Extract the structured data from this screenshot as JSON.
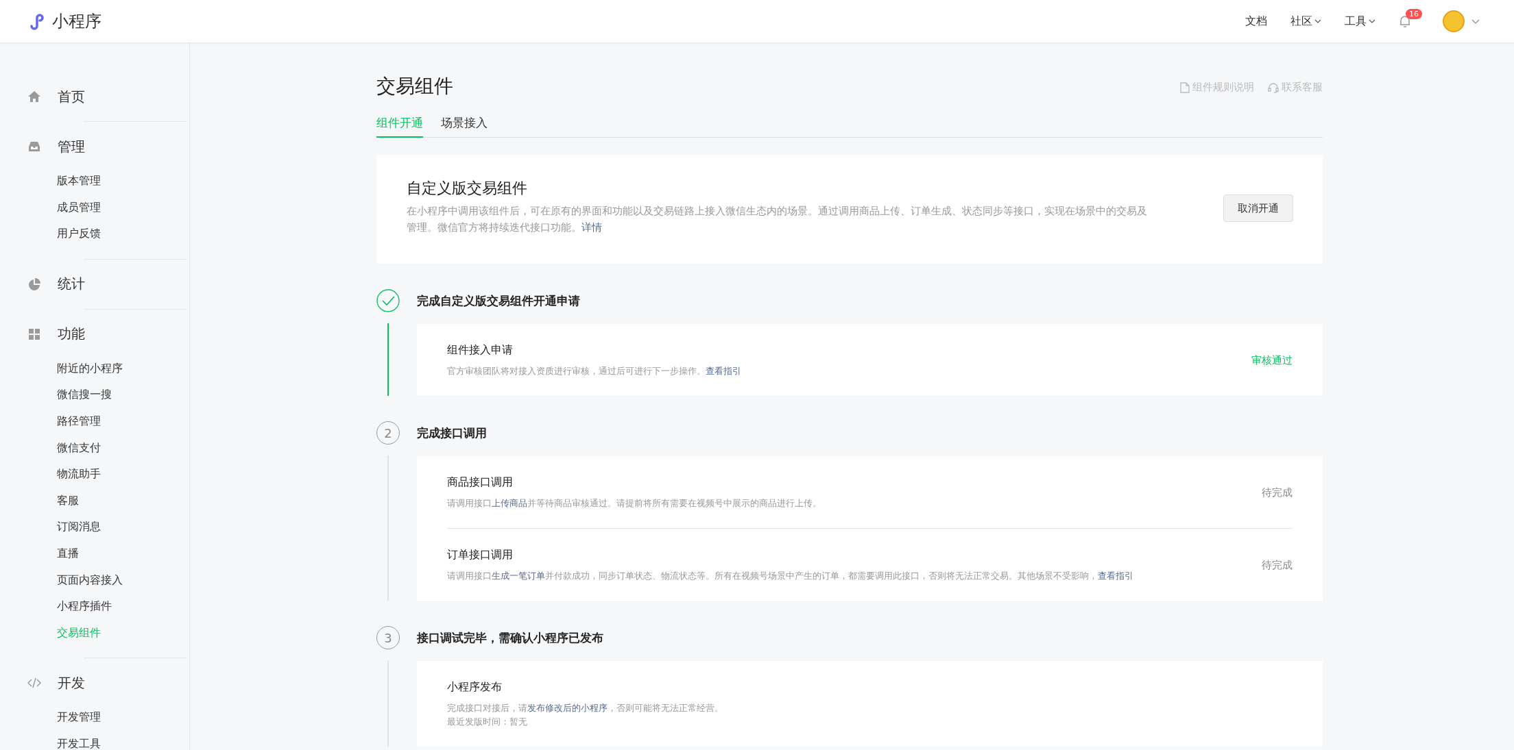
{
  "topbar": {
    "logo_text": "小程序",
    "nav": [
      {
        "label": "文档",
        "dropdown": false
      },
      {
        "label": "社区",
        "dropdown": true
      },
      {
        "label": "工具",
        "dropdown": true
      }
    ],
    "notification_count": "16"
  },
  "sidebar": {
    "groups": [
      {
        "label": "首页"
      },
      {
        "label": "管理",
        "children": [
          {
            "label": "版本管理",
            "selected": false
          },
          {
            "label": "成员管理",
            "selected": false
          },
          {
            "label": "用户反馈",
            "selected": false
          }
        ]
      },
      {
        "label": "统计"
      },
      {
        "label": "功能",
        "children": [
          {
            "label": "附近的小程序",
            "selected": false
          },
          {
            "label": "微信搜一搜",
            "selected": false
          },
          {
            "label": "路径管理",
            "selected": false
          },
          {
            "label": "微信支付",
            "selected": false
          },
          {
            "label": "物流助手",
            "selected": false
          },
          {
            "label": "客服",
            "selected": false
          },
          {
            "label": "订阅消息",
            "selected": false
          },
          {
            "label": "直播",
            "selected": false
          },
          {
            "label": "页面内容接入",
            "selected": false
          },
          {
            "label": "小程序插件",
            "selected": false
          },
          {
            "label": "交易组件",
            "selected": true
          }
        ]
      },
      {
        "label": "开发",
        "children": [
          {
            "label": "开发管理",
            "selected": false
          },
          {
            "label": "开发工具",
            "selected": false
          }
        ]
      }
    ]
  },
  "page": {
    "title": "交易组件",
    "header_links": [
      {
        "label": "组件规则说明"
      },
      {
        "label": "联系客服"
      }
    ],
    "tabs": [
      {
        "label": "组件开通",
        "selected": true
      },
      {
        "label": "场景接入",
        "selected": false
      }
    ],
    "intro_card": {
      "title": "自定义版交易组件",
      "description": [
        {
          "text": "在小程序中调用该组件后，可在原有的界面和功能以及交易链路上接入微信生态内的场景。通过调用商品上传、订单生成、状态同步等接口，实现在场景中的交易及管理。微信官方将持续迭代接口功能。",
          "kind": "text"
        },
        {
          "text": "详情",
          "kind": "link"
        }
      ],
      "button": "取消开通"
    },
    "steps": [
      {
        "done": true,
        "title": "完成自定义版交易组件开通申请",
        "items": [
          {
            "title": "组件接入申请",
            "description": [
              {
                "text": "官方审核团队将对接入资质进行审核，通过后可进行下一步操作。",
                "kind": "text"
              },
              {
                "text": "查看指引",
                "kind": "link"
              }
            ],
            "status": "审核通过",
            "approved": true
          }
        ]
      },
      {
        "done": false,
        "number": "2",
        "title": "完成接口调用",
        "items": [
          {
            "title": "商品接口调用",
            "description": [
              {
                "text": "请调用接口",
                "kind": "text"
              },
              {
                "text": "上传商品",
                "kind": "link"
              },
              {
                "text": "并等待商品审核通过。请提前将所有需要在视频号中展示的商品进行上传。",
                "kind": "text"
              }
            ],
            "status": "待完成",
            "approved": false
          },
          {
            "title": "订单接口调用",
            "description": [
              {
                "text": "请调用接口",
                "kind": "text"
              },
              {
                "text": "生成一笔订单",
                "kind": "link"
              },
              {
                "text": "并付款成功，同步订单状态、物流状态等。所有在视频号场景中产生的订单，都需要调用此接口，否则将无法正常交易。其他场景不受影响，",
                "kind": "text"
              },
              {
                "text": "查看指引",
                "kind": "link"
              }
            ],
            "status": "待完成",
            "approved": false
          }
        ]
      },
      {
        "done": false,
        "number": "3",
        "title": "接口调试完毕，需确认小程序已发布",
        "items": [
          {
            "title": "小程序发布",
            "description": [
              {
                "text": "完成接口对接后，请",
                "kind": "text"
              },
              {
                "text": "发布修改后的小程序",
                "kind": "link"
              },
              {
                "text": "，否则可能将无法正常经营。",
                "kind": "text"
              }
            ],
            "note": "最近发版时间：暂无"
          }
        ]
      }
    ]
  }
}
